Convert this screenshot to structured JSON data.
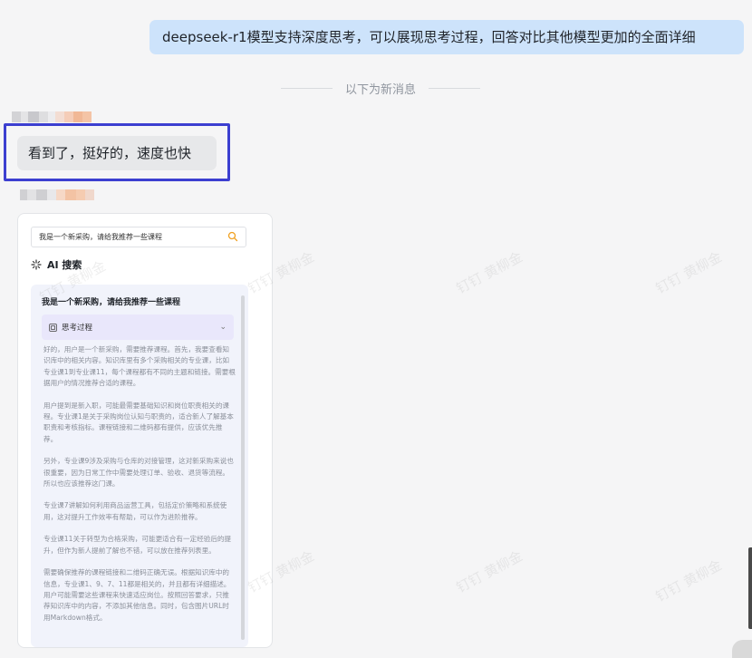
{
  "outgoing_message": "deepseek-r1模型支持深度思考，可以展现思考过程，回答对比其他模型更加的全面详细",
  "divider_text": "以下为新消息",
  "incoming_message": "看到了，挺好的，速度也快",
  "card": {
    "search_value": "我是一个新采购，请给我推荐一些课程",
    "ai_search_title": "AI 搜索",
    "question_title": "我是一个新采购，请给我推荐一些课程",
    "thinking_label": "思考过程",
    "thinking_paragraphs": [
      "好的，用户是一个新采购，需要推荐课程。首先，我要查看知识库中的相关内容。知识库里有多个采购相关的专业课，比如专业课1到专业课11，每个课程都有不同的主题和链接。需要根据用户的情况推荐合适的课程。",
      "用户提到是新入职，可能最需要基础知识和岗位职责相关的课程。专业课1是关于采购岗位认知与职责的，适合新人了解基本职责和考核指标。课程链接和二维码都有提供，应该优先推荐。",
      "另外，专业课9涉及采购与仓库的对接管理，这对新采购来说也很重要，因为日常工作中需要处理订单、验收、退货等流程。所以也应该推荐这门课。",
      "专业课7讲解如何利用商品运营工具，包括定价策略和系统使用，这对提升工作效率有帮助，可以作为进阶推荐。",
      "专业课11关于转型为合格采购，可能更适合有一定经验后的提升，但作为新人提前了解也不错，可以放在推荐列表里。",
      "需要确保推荐的课程链接和二维码正确无误。根据知识库中的信息，专业课1、9、7、11都是相关的，并且都有详细描述。用户可能需要这些课程来快速适应岗位。按照回答要求，只推荐知识库中的内容，不添加其他信息。同时，包含图片URL时用Markdown格式。"
    ]
  },
  "watermark": "钉钉 黄柳金",
  "colors": {
    "outgoing_bubble": "#cde3fb",
    "incoming_bubble": "#e7e8ea",
    "highlight": "#3c3fd0",
    "thinking_header": "#e9e7fb",
    "search_icon": "#f0a020"
  }
}
